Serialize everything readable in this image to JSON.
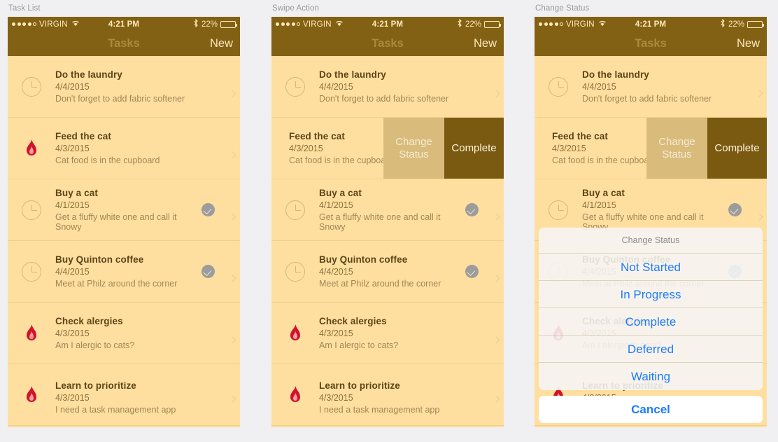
{
  "panels": [
    {
      "caption": "Task List"
    },
    {
      "caption": "Swipe Action"
    },
    {
      "caption": "Change Status"
    }
  ],
  "status_bar": {
    "carrier": "VIRGIN",
    "time": "4:21 PM",
    "battery_percent": "22%",
    "signal_dots_filled": 4,
    "signal_dots_total": 5,
    "wifi_icon": "wifi-icon",
    "bluetooth_icon": "bluetooth-icon",
    "battery_icon": "battery-icon"
  },
  "nav_bar": {
    "title": "Tasks",
    "action_label": "New"
  },
  "tasks": [
    {
      "title": "Do the laundry",
      "date": "4/4/2015",
      "note": "Don't forget to add fabric softener",
      "priority_icon": "clock-icon",
      "completed": false
    },
    {
      "title": "Feed the cat",
      "date": "4/3/2015",
      "note": "Cat food is in the cupboard",
      "priority_icon": "flame-icon",
      "completed": false
    },
    {
      "title": "Buy a cat",
      "date": "4/1/2015",
      "note": "Get a fluffy white one and call it Snowy",
      "priority_icon": "clock-icon",
      "completed": true
    },
    {
      "title": "Buy Quinton coffee",
      "date": "4/4/2015",
      "note": "Meet at Philz around the corner",
      "priority_icon": "clock-icon",
      "completed": true
    },
    {
      "title": "Check alergies",
      "date": "4/3/2015",
      "note": "Am I alergic to cats?",
      "priority_icon": "flame-icon",
      "completed": false
    },
    {
      "title": "Learn to prioritize",
      "date": "4/3/2015",
      "note": "I need a task management app",
      "priority_icon": "flame-icon",
      "completed": false
    }
  ],
  "swipe_actions": {
    "change_status_label": "Change\nStatus",
    "change_status_line1": "Change",
    "change_status_line2": "Status",
    "complete_label": "Complete",
    "swiped_task_index": 1
  },
  "action_sheet": {
    "title": "Change Status",
    "options": [
      "Not Started",
      "In Progress",
      "Complete",
      "Deferred",
      "Waiting"
    ],
    "cancel_label": "Cancel"
  },
  "colors": {
    "nav_bar": "#836114",
    "list_background": "#ffdfa0",
    "page_background": "#f0f0f2",
    "swipe_change_status": "#d9bc7c",
    "swipe_complete": "#7a5a10",
    "action_link": "#1d7bfb",
    "flame": "#d1132c"
  }
}
